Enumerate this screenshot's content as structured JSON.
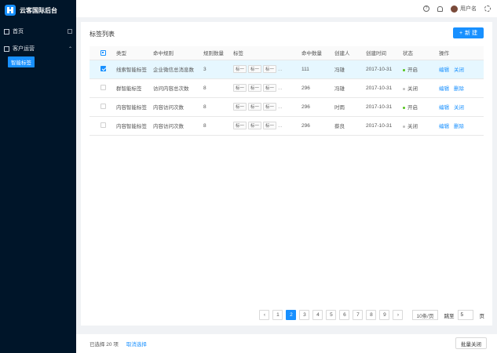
{
  "brand": {
    "title": "云客国际后台"
  },
  "sidebar": {
    "items": [
      {
        "label": "首页"
      },
      {
        "label": "客户运营"
      }
    ],
    "sub_items": [
      {
        "label": "智能标签"
      }
    ]
  },
  "header": {
    "username": "用户名"
  },
  "page": {
    "title": "标签列表",
    "new_button": "新 建"
  },
  "table": {
    "columns": [
      "类型",
      "命中规则",
      "规则数量",
      "标签",
      "命中数量",
      "创建人",
      "创建时间",
      "状态",
      "操作"
    ],
    "rows": [
      {
        "type": "线索智能标签",
        "rule": "企业微信总消息数",
        "rule_count": "3",
        "tags": [
          "标一",
          "标一",
          "标一"
        ],
        "hits": "111",
        "creator": "冯雄",
        "created": "2017-10-31",
        "status": "开启",
        "status_color": "#52c41a",
        "op1": "编辑",
        "op2": "关闭",
        "selected": true
      },
      {
        "type": "群智能标签",
        "rule": "访问内容总次数",
        "rule_count": "8",
        "tags": [
          "标一",
          "标一",
          "标一"
        ],
        "hits": "296",
        "creator": "冯雄",
        "created": "2017-10-31",
        "status": "关闭",
        "status_color": "#bfbfbf",
        "op1": "编辑",
        "op2": "删除",
        "selected": false
      },
      {
        "type": "内容智能标签",
        "rule": "内容访问次数",
        "rule_count": "8",
        "tags": [
          "标一",
          "标一",
          "标一"
        ],
        "hits": "296",
        "creator": "时雨",
        "created": "2017-10-31",
        "status": "开启",
        "status_color": "#52c41a",
        "op1": "编辑",
        "op2": "关闭",
        "selected": false
      },
      {
        "type": "内容智能标签",
        "rule": "内容访问次数",
        "rule_count": "8",
        "tags": [
          "标一",
          "标一",
          "标一"
        ],
        "hits": "296",
        "creator": "蔡良",
        "created": "2017-10-31",
        "status": "关闭",
        "status_color": "#bfbfbf",
        "op1": "编辑",
        "op2": "删除",
        "selected": false
      }
    ],
    "ellipsis": "..."
  },
  "pagination": {
    "pages": [
      "1",
      "2",
      "3",
      "4",
      "5",
      "6",
      "7",
      "8",
      "9"
    ],
    "current": "2",
    "prev": "‹",
    "next": "›",
    "page_size": "10条/页",
    "jump_label": "跳至",
    "jump_value": "5",
    "page_suffix": "页"
  },
  "footer": {
    "selected_text": "已选择 20 项",
    "cancel_selection": "取消选择",
    "batch_close": "批量关闭"
  },
  "colors": {
    "accent": "#1890ff",
    "sidebar_bg": "#001529"
  }
}
